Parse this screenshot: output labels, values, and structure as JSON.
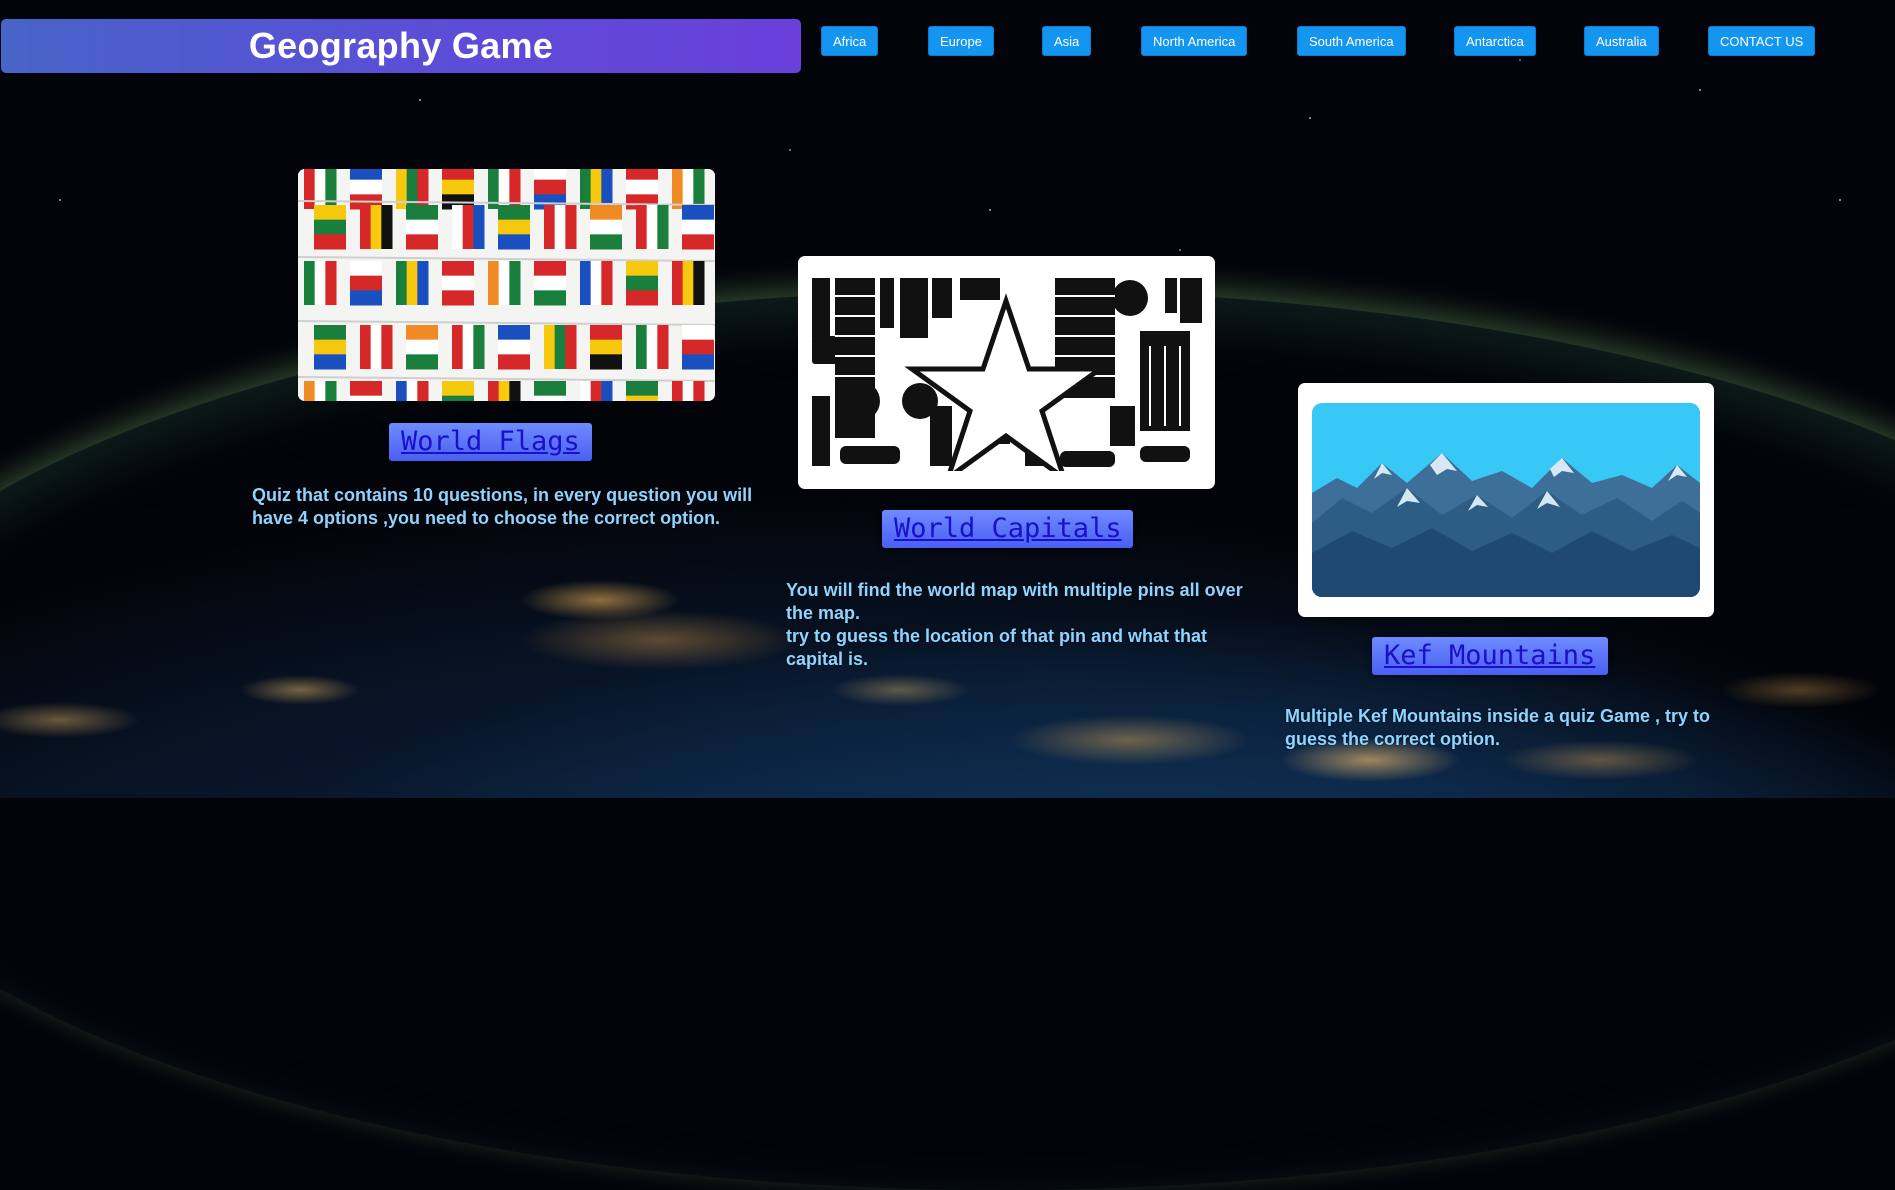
{
  "header": {
    "title": "Geography Game"
  },
  "nav": {
    "items": [
      {
        "label": "Africa"
      },
      {
        "label": "Europe"
      },
      {
        "label": "Asia"
      },
      {
        "label": "North America"
      },
      {
        "label": "South America"
      },
      {
        "label": "Antarctica"
      },
      {
        "label": "Australia"
      },
      {
        "label": "CONTACT US"
      }
    ]
  },
  "cards": [
    {
      "title": "World Flags",
      "image_icon": "flags-image",
      "description": [
        "Quiz that contains 10 questions, in every question you will have 4 options ,you need to choose the correct option."
      ]
    },
    {
      "title": "World Capitals",
      "image_icon": "city-star-image",
      "description": [
        "You will find the world map with multiple pins all over the map.",
        "try to guess the location of that pin and what that capital is."
      ]
    },
    {
      "title": "Kef Mountains",
      "image_icon": "mountains-image",
      "description": [
        "Multiple Kef Mountains inside a quiz Game , try to guess the correct option."
      ]
    }
  ],
  "colors": {
    "title_gradient": [
      "#4764c8",
      "#6a3fdc"
    ],
    "nav_button": "#1496f0",
    "description_text": "#8fd3ff",
    "link_text": "#1a10c8",
    "mountain_sky": "#38c8f5"
  }
}
